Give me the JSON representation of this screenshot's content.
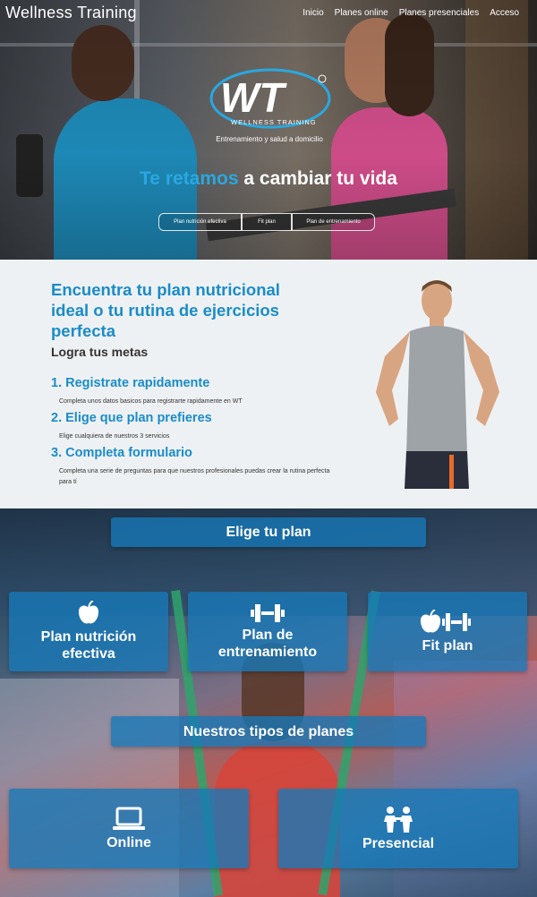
{
  "header": {
    "brand": "Wellness Training",
    "nav": [
      "Inicio",
      "Planes online",
      "Planes presenciales",
      "Acceso"
    ]
  },
  "hero": {
    "logo_text": "WT",
    "logo_subtitle": "WELLNESS TRAINING",
    "tagline": "Entrenamiento y salud a domicilio",
    "title_highlight": "Te retamos",
    "title_rest": "a cambiar tu vida",
    "pills": [
      "Plan nutrición efectiva",
      "Fit plan",
      "Plan de entrenamiento"
    ]
  },
  "info": {
    "heading": "Encuentra tu plan nutricional ideal o tu rutina de ejercicios perfecta",
    "subheading": "Logra tus metas",
    "steps": [
      {
        "title": "1. Registrate rapidamente",
        "desc": "Completa unos datos basicos para registrarte rapidamente en WT"
      },
      {
        "title": "2. Elige que plan prefieres",
        "desc": "Elige cualquiera de nuestros 3 servicios"
      },
      {
        "title": "3. Completa formulario",
        "desc": "Completa una serie de preguntas para que nuestros profesionales puedas crear la rutina perfecta para tí"
      }
    ]
  },
  "plans": {
    "choose_label": "Elige tu plan",
    "cards": [
      {
        "label": "Plan nutrición efectiva",
        "icon": "apple-icon"
      },
      {
        "label": "Plan de entrenamiento",
        "icon": "dumbbell-icon"
      },
      {
        "label": "Fit plan",
        "icon": "apple-dumbbell-icon"
      }
    ],
    "types_label": "Nuestros tipos de planes",
    "types": [
      {
        "label": "Online",
        "icon": "laptop-icon"
      },
      {
        "label": "Presencial",
        "icon": "people-icon"
      }
    ]
  },
  "colors": {
    "accent": "#1a8cc9",
    "hero_highlight": "#29a8e0",
    "card_bg": "#1678b9"
  }
}
